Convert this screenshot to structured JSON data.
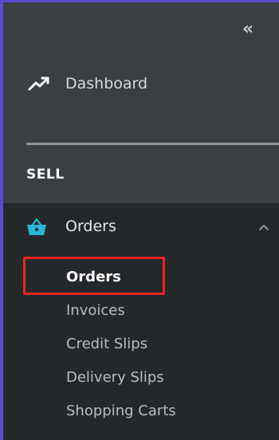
{
  "sidebar": {
    "collapse_label": "«",
    "dashboard": {
      "label": "Dashboard",
      "icon": "trending-up-icon"
    },
    "section_title": "SELL",
    "orders": {
      "label": "Orders",
      "icon": "shopping-basket-icon",
      "accent_color": "#25b9d7",
      "expanded": true,
      "items": [
        {
          "label": "Orders",
          "active": true
        },
        {
          "label": "Invoices",
          "active": false
        },
        {
          "label": "Credit Slips",
          "active": false
        },
        {
          "label": "Delivery Slips",
          "active": false
        },
        {
          "label": "Shopping Carts",
          "active": false
        }
      ]
    }
  },
  "colors": {
    "frame_border": "#5b4bd1",
    "upper_bg": "#3b3f43",
    "lower_bg": "#25282b",
    "highlight": "#ee2222"
  }
}
